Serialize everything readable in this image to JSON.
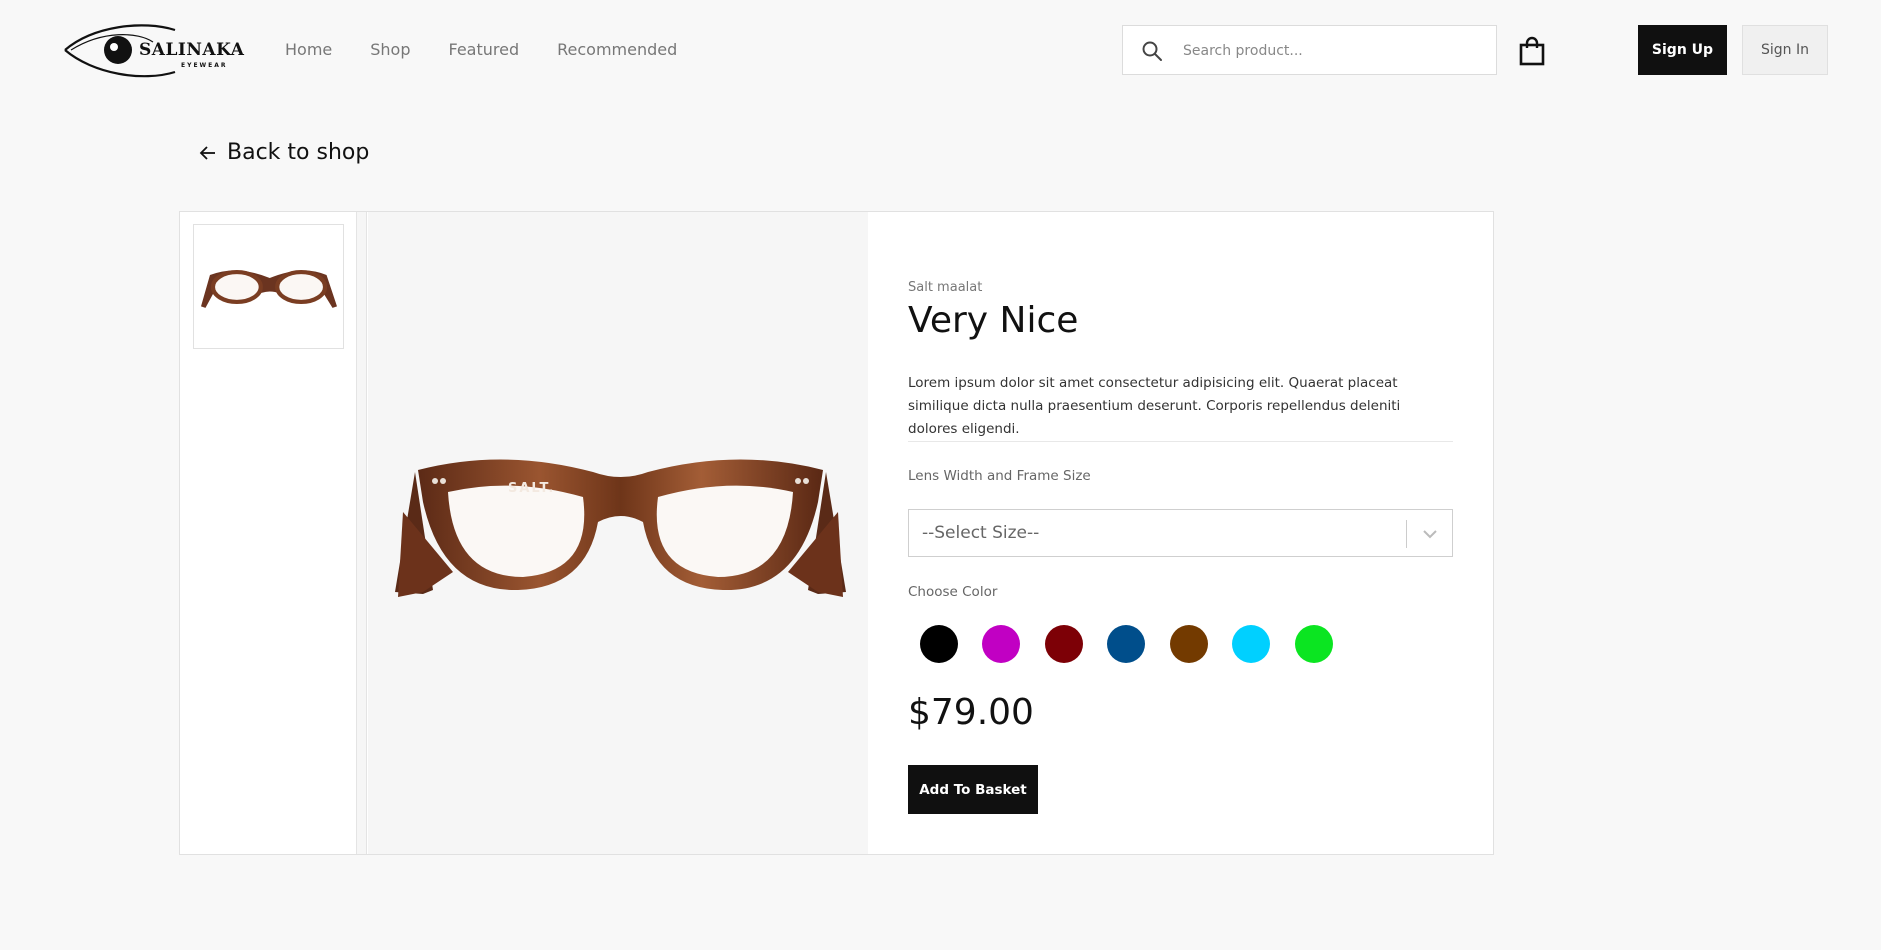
{
  "header": {
    "logo_text": "SALINAKA",
    "logo_subtext": "EYEWEAR",
    "nav": [
      "Home",
      "Shop",
      "Featured",
      "Recommended"
    ],
    "search_placeholder": "Search product...",
    "signup_label": "Sign Up",
    "signin_label": "Sign In"
  },
  "back_label": "Back to shop",
  "product": {
    "brand": "Salt maalat",
    "name": "Very Nice",
    "description": "Lorem ipsum dolor sit amet consectetur adipisicing elit. Quaerat placeat similique dicta nulla praesentium deserunt. Corporis repellendus deleniti dolores eligendi.",
    "size_label": "Lens Width and Frame Size",
    "size_placeholder": "--Select Size--",
    "color_label": "Choose Color",
    "colors": [
      "#000000",
      "#c100c3",
      "#7d0006",
      "#004e8b",
      "#733a00",
      "#00d0ff",
      "#0be521"
    ],
    "price": "$79.00",
    "add_label": "Add To Basket"
  },
  "icons": {
    "logo": "eye-logo-icon",
    "search": "search-icon",
    "basket": "shopping-bag-icon",
    "back": "arrow-left-icon",
    "select": "chevron-down-icon"
  }
}
